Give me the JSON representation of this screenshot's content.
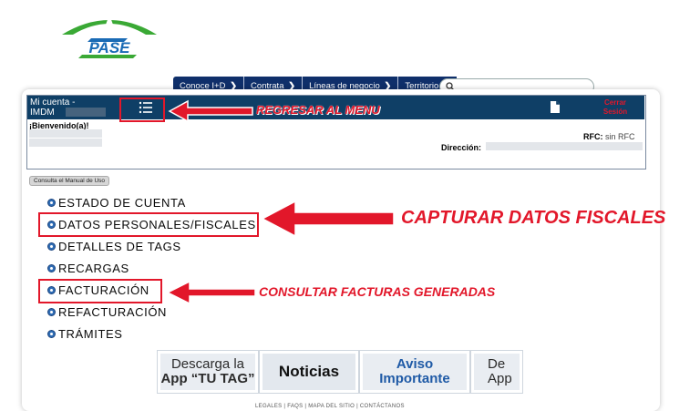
{
  "logo": {
    "text": "PASE"
  },
  "nav": {
    "items": [
      {
        "label": "Conoce I+D"
      },
      {
        "label": "Contrata"
      },
      {
        "label": "Líneas de negocio"
      },
      {
        "label": "Territorio"
      }
    ],
    "chevron": "❯"
  },
  "search": {
    "value": "",
    "icon": "search-icon"
  },
  "account": {
    "title": "Mi cuenta -",
    "id_prefix": "IMDM",
    "welcome": "¡Bienvenido(a)!",
    "logout": "Cerrar Sesión",
    "rfc_label": "RFC:",
    "rfc_value": "sin RFC",
    "address_label": "Dirección:"
  },
  "manual_button": "Consulta el Manual de Uso",
  "menu": [
    {
      "label": "ESTADO DE CUENTA"
    },
    {
      "label": "DATOS PERSONALES/FISCALES"
    },
    {
      "label": "DETALLES DE TAGS"
    },
    {
      "label": "RECARGAS"
    },
    {
      "label": "FACTURACIÓN"
    },
    {
      "label": "REFACTURACIÓN"
    },
    {
      "label": "TRÁMITES"
    }
  ],
  "annotations": {
    "menu": "REGRESAR AL MENU",
    "fiscal": "CAPTURAR DATOS FISCALES",
    "invoices": "CONSULTAR FACTURAS GENERADAS"
  },
  "banners": {
    "app_line1": "Descarga la",
    "app_line2": "App “TU TAG”",
    "news": "Noticias",
    "notice_line1": "Aviso",
    "notice_line2": "Importante",
    "partial_line1": "De",
    "partial_line2": "App"
  },
  "footer": "LEGALES | FAQS | MAPA DEL SITIO | CONTÁCTANOS",
  "colors": {
    "nav_bg": "#0f2f6a",
    "account_bar": "#0f3f66",
    "annotation_red": "#e2172a",
    "logo_green": "#3aa935",
    "logo_blue": "#1a6bb5"
  }
}
